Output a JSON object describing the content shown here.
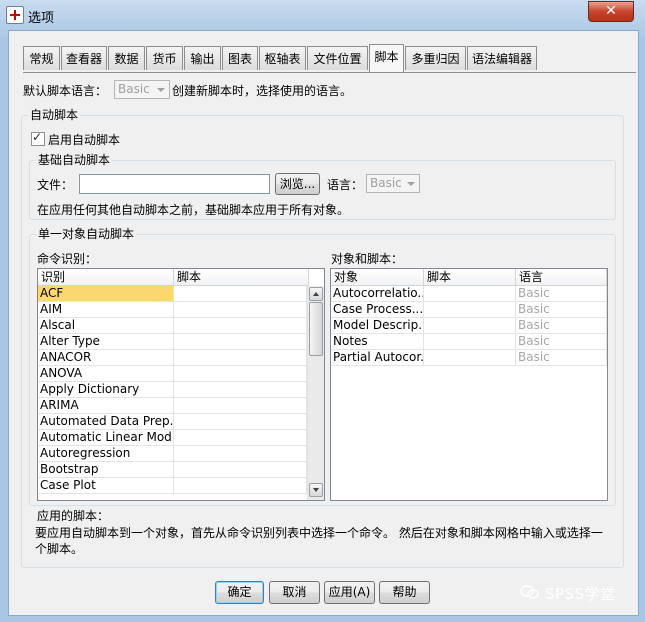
{
  "window": {
    "title": "选项"
  },
  "tabs": [
    {
      "label": "常规"
    },
    {
      "label": "查看器"
    },
    {
      "label": "数据"
    },
    {
      "label": "货币"
    },
    {
      "label": "输出"
    },
    {
      "label": "图表"
    },
    {
      "label": "枢轴表"
    },
    {
      "label": "文件位置"
    },
    {
      "label": "脚本",
      "active": true
    },
    {
      "label": "多重归因"
    },
    {
      "label": "语法编辑器"
    }
  ],
  "default_language": {
    "label": "默认脚本语言：",
    "value": "Basic",
    "hint": "创建新脚本时，选择使用的语言。"
  },
  "autoscript": {
    "group_title": "自动脚本",
    "enable_label": "启用自动脚本",
    "base": {
      "group_title": "基础自动脚本",
      "file_label": "文件：",
      "file_value": "",
      "browse_label": "浏览...",
      "language_label": "语言：",
      "language_value": "Basic",
      "note": "在应用任何其他自动脚本之前，基础脚本应用于所有对象。"
    },
    "single": {
      "group_title": "单一对象自动脚本",
      "command_label": "命令识别：",
      "command_headers": [
        "识别",
        "脚本"
      ],
      "commands": [
        "ACF",
        "AIM",
        "Alscal",
        "Alter Type",
        "ANACOR",
        "ANOVA",
        "Apply Dictionary",
        "ARIMA",
        "Automated Data Prep...",
        "Automatic Linear Mod...",
        "Autoregression",
        "Bootstrap",
        "Case Plot"
      ],
      "selected_index": 0,
      "objects_label": "对象和脚本：",
      "object_headers": [
        "对象",
        "脚本",
        "语言"
      ],
      "objects": [
        {
          "name": "Autocorrelatio...",
          "script": "",
          "lang": "Basic"
        },
        {
          "name": "Case Process...",
          "script": "",
          "lang": "Basic"
        },
        {
          "name": "Model Descrip...",
          "script": "",
          "lang": "Basic"
        },
        {
          "name": "Notes",
          "script": "",
          "lang": "Basic"
        },
        {
          "name": "Partial Autocor...",
          "script": "",
          "lang": "Basic"
        }
      ]
    },
    "apply_title": "应用的脚本：",
    "apply_text": "要应用自动脚本到一个对象，首先从命令识别列表中选择一个命令。 然后在对象和脚本网格中输入或选择一个脚本。"
  },
  "buttons": {
    "ok": "确定",
    "cancel": "取消",
    "apply": "应用(A)",
    "help": "帮助"
  },
  "watermark": {
    "text": "SPSS学堂"
  }
}
